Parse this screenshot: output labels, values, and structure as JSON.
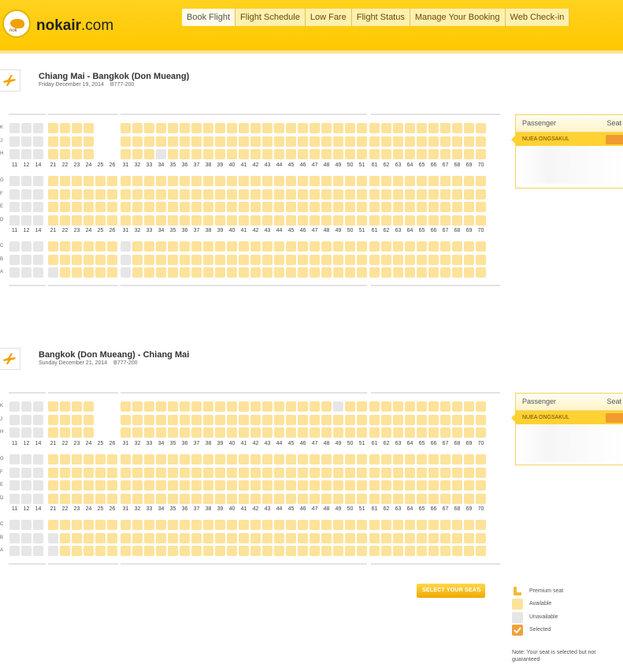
{
  "header": {
    "logo_text_main": "nokair",
    "logo_text_tld": ".com",
    "logo_wordmark": "nok",
    "nav": [
      "Book Flight",
      "Flight Schedule",
      "Low Fare",
      "Flight Status",
      "Manage Your Booking",
      "Web Check-in"
    ]
  },
  "flights": [
    {
      "route": "Chiang Mai - Bangkok (Don Mueang)",
      "date": "Friday December 19, 2014",
      "aircraft": "B777-200",
      "passenger_header": "Passenger",
      "seat_header": "Seat",
      "passenger_name": "NUEA ONGSAKUL"
    },
    {
      "route": "Bangkok (Don Mueang) - Chiang Mai",
      "date": "Sunday December 21, 2014",
      "aircraft": "B777-200",
      "passenger_header": "Passenger",
      "seat_header": "Seat",
      "passenger_name": "NUEA ONGSAKUL"
    }
  ],
  "seat_map": {
    "upper_rows": [
      "K",
      "J",
      "H"
    ],
    "middle_rows": [
      "G",
      "F",
      "E",
      "D"
    ],
    "lower_rows": [
      "C",
      "B",
      "A"
    ],
    "columns": [
      "11",
      "12",
      "14",
      "21",
      "22",
      "23",
      "24",
      "25",
      "26",
      "31",
      "32",
      "33",
      "34",
      "35",
      "36",
      "37",
      "38",
      "39",
      "40",
      "41",
      "42",
      "43",
      "44",
      "45",
      "46",
      "47",
      "48",
      "49",
      "50",
      "51",
      "61",
      "62",
      "63",
      "64",
      "65",
      "66",
      "67",
      "68",
      "69",
      "70"
    ]
  },
  "select_button": "SELECT YOUR SEAT",
  "legend": {
    "items": [
      {
        "label": "Premium seat",
        "icon": "premium-seat-icon",
        "color": "#f4b93a"
      },
      {
        "label": "Available",
        "icon": "available-seat-icon",
        "color": "#fde29a"
      },
      {
        "label": "Unavailable",
        "icon": "unavailable-seat-icon",
        "color": "#e6e6e6"
      },
      {
        "label": "Selected",
        "icon": "selected-seat-icon",
        "color": "#f2a13a"
      }
    ],
    "note": "Note: Your seat is selected but not guaranteed"
  },
  "colors": {
    "brand_yellow": "#ffcb05",
    "available": "#fde29a",
    "unavailable": "#e6e6e6",
    "selected": "#f09a30"
  }
}
